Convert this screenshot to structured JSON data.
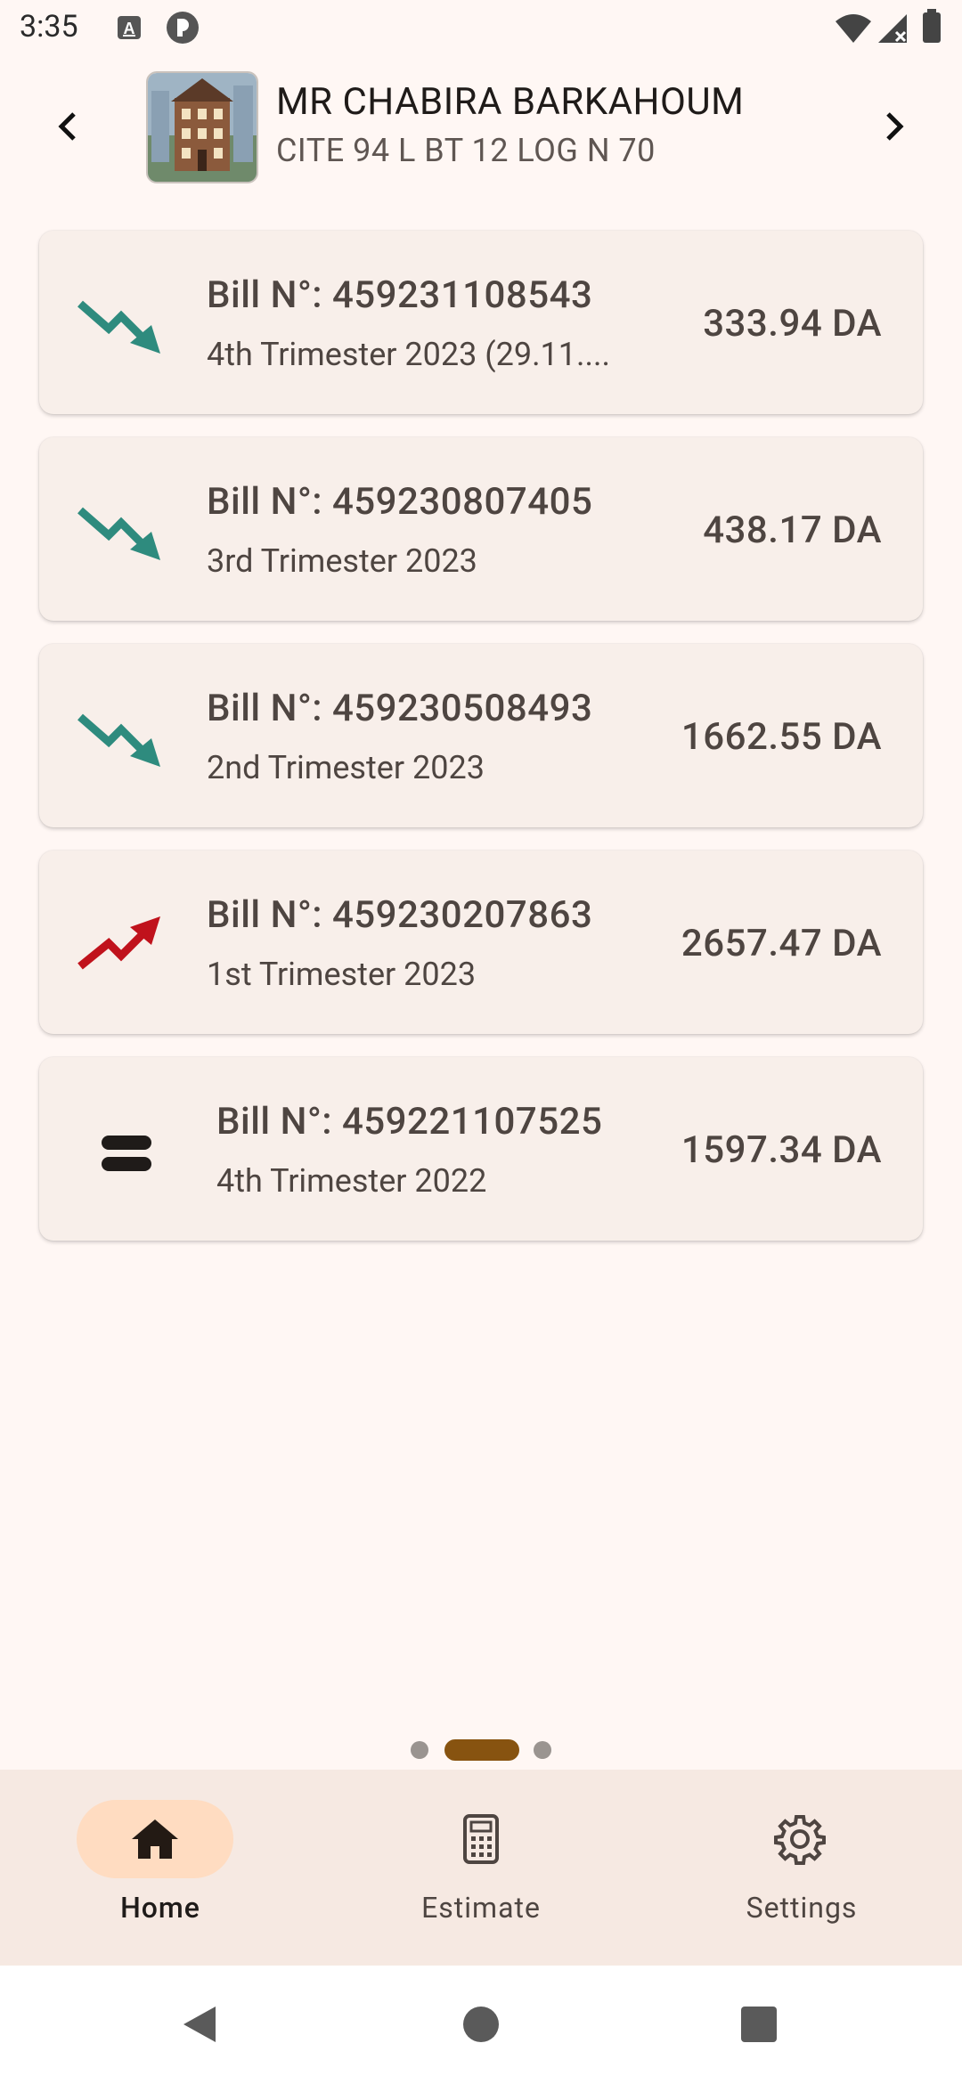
{
  "status_bar": {
    "time": "3:35"
  },
  "header": {
    "customer_name": "MR CHABIRA BARKAHOUM",
    "customer_address": "CITE 94 L BT 12 LOG N 70"
  },
  "bills": [
    {
      "number": "Bill N°: 459231108543",
      "period": " 4th Trimester 2023  (29.11....",
      "amount": "333.94 DA",
      "trend": "down"
    },
    {
      "number": "Bill N°: 459230807405",
      "period": "3rd Trimester 2023",
      "amount": "438.17 DA",
      "trend": "down"
    },
    {
      "number": "Bill N°: 459230508493",
      "period": "2nd Trimester 2023",
      "amount": "1662.55 DA",
      "trend": "down"
    },
    {
      "number": "Bill N°: 459230207863",
      "period": "1st Trimester 2023",
      "amount": "2657.47 DA",
      "trend": "up"
    },
    {
      "number": "Bill N°: 459221107525",
      "period": "4th Trimester 2022",
      "amount": "1597.34 DA",
      "trend": "equal"
    }
  ],
  "pager": {
    "pages": 3,
    "active_index": 1
  },
  "bottom_nav": {
    "items": [
      {
        "label": "Home",
        "icon": "home-icon",
        "active": true
      },
      {
        "label": "Estimate",
        "icon": "calculator-icon",
        "active": false
      },
      {
        "label": "Settings",
        "icon": "gear-icon",
        "active": false
      }
    ]
  },
  "colors": {
    "trend_down": "#2E8B7E",
    "trend_up": "#C0121C",
    "accent": "#875310",
    "active_pill": "#FFDCC1"
  }
}
